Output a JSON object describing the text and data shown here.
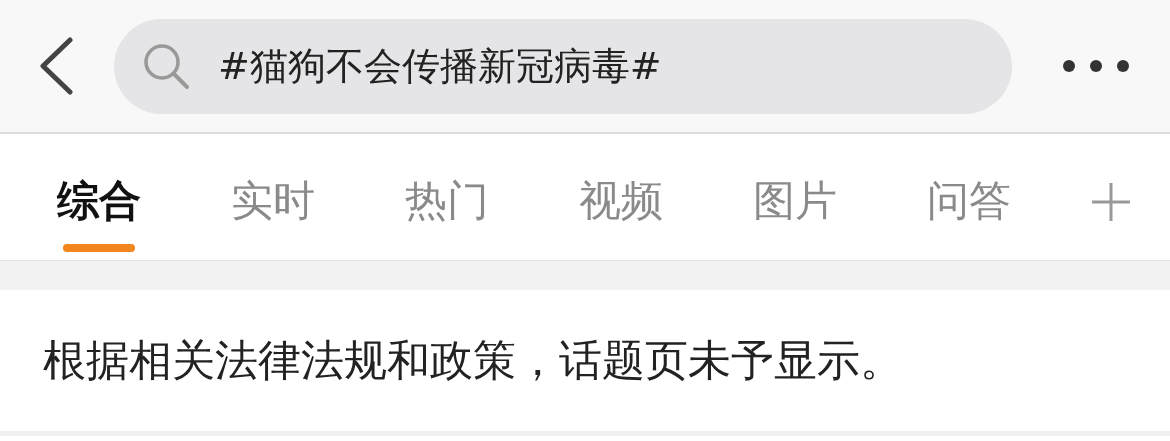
{
  "search": {
    "value": "#猫狗不会传播新冠病毒#"
  },
  "tabs": [
    {
      "label": "综合",
      "selected": true
    },
    {
      "label": "实时",
      "selected": false
    },
    {
      "label": "热门",
      "selected": false
    },
    {
      "label": "视频",
      "selected": false
    },
    {
      "label": "图片",
      "selected": false
    },
    {
      "label": "问答",
      "selected": false
    }
  ],
  "notice": "根据相关法律法规和政策，话题页未予显示。"
}
